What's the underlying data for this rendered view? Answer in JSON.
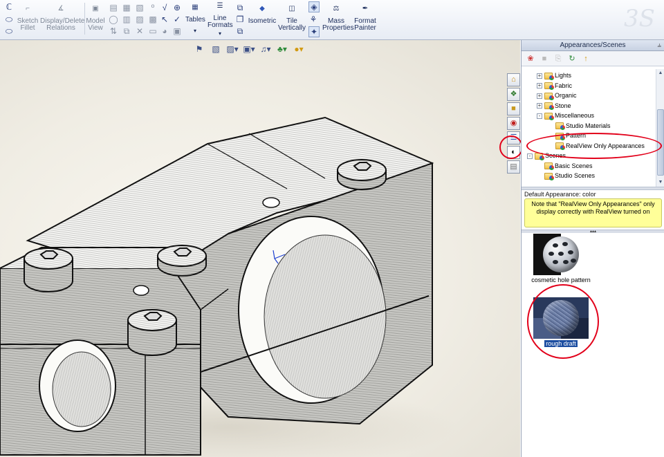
{
  "ribbon": {
    "sketch_fillet": "Sketch Fillet",
    "display_delete_relations": "Display/Delete Relations",
    "model_view": "Model View",
    "tables": "Tables",
    "line_formats": "Line Formats",
    "isometric": "Isometric",
    "tile_vertically": "Tile Vertically",
    "mass_properties": "Mass Properties",
    "format_painter": "Format Painter"
  },
  "task_pane": {
    "title": "Appearances/Scenes",
    "tree": [
      {
        "label": "Lights",
        "level": 1,
        "expander": "+"
      },
      {
        "label": "Fabric",
        "level": 1,
        "expander": "+"
      },
      {
        "label": "Organic",
        "level": 1,
        "expander": "+"
      },
      {
        "label": "Stone",
        "level": 1,
        "expander": "+"
      },
      {
        "label": "Miscellaneous",
        "level": 1,
        "expander": "-"
      },
      {
        "label": "Studio Materials",
        "level": 2,
        "expander": ""
      },
      {
        "label": "Pattern",
        "level": 2,
        "expander": ""
      },
      {
        "label": "RealView Only Appearances",
        "level": 2,
        "expander": ""
      },
      {
        "label": "Scenes",
        "level": 0,
        "expander": "-"
      },
      {
        "label": "Basic Scenes",
        "level": 1,
        "expander": ""
      },
      {
        "label": "Studio Scenes",
        "level": 1,
        "expander": ""
      }
    ],
    "default_appearance": "Default Appearance: color",
    "note": "Note that \"RealView Only Appearances\" only display correctly with RealView turned on",
    "swatches": [
      {
        "label": "cosmetic hole pattern",
        "selected": false
      },
      {
        "label": "rough draft",
        "selected": true
      }
    ]
  },
  "colors": {
    "highlight_ring": "#e2001a",
    "selection": "#1d4ea1",
    "note_bg": "#ffff99"
  }
}
